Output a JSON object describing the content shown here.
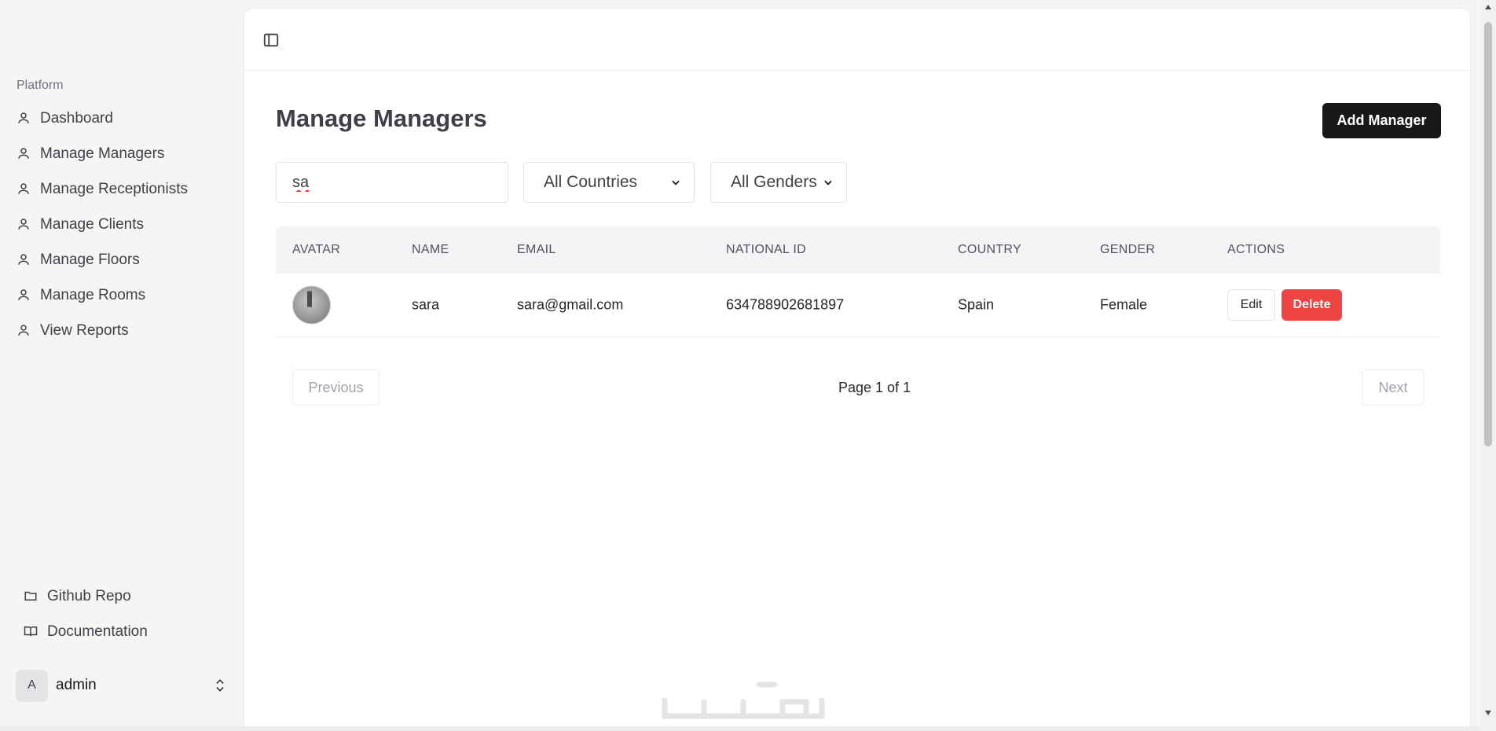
{
  "sidebar": {
    "group_label": "Platform",
    "items": [
      {
        "label": "Dashboard",
        "icon": "user-icon"
      },
      {
        "label": "Manage Managers",
        "icon": "user-icon"
      },
      {
        "label": "Manage Receptionists",
        "icon": "user-icon"
      },
      {
        "label": "Manage Clients",
        "icon": "user-icon"
      },
      {
        "label": "Manage Floors",
        "icon": "user-icon"
      },
      {
        "label": "Manage Rooms",
        "icon": "user-icon"
      },
      {
        "label": "View Reports",
        "icon": "user-icon"
      }
    ],
    "footer_links": [
      {
        "label": "Github Repo",
        "icon": "folder-icon"
      },
      {
        "label": "Documentation",
        "icon": "book-icon"
      }
    ],
    "user": {
      "initial": "A",
      "name": "admin"
    }
  },
  "main": {
    "title": "Manage Managers",
    "add_button": "Add Manager",
    "search_value": "sa",
    "country_filter": "All Countries",
    "gender_filter": "All Genders",
    "table": {
      "headers": [
        "AVATAR",
        "NAME",
        "EMAIL",
        "NATIONAL ID",
        "COUNTRY",
        "GENDER",
        "ACTIONS"
      ],
      "rows": [
        {
          "name": "sara",
          "email": "sara@gmail.com",
          "national_id": "634788902681897",
          "country": "Spain",
          "gender": "Female",
          "edit": "Edit",
          "delete": "Delete"
        }
      ]
    },
    "pagination": {
      "previous": "Previous",
      "info": "Page 1 of 1",
      "next": "Next"
    }
  },
  "colors": {
    "primary": "#18181b",
    "danger": "#ef4444",
    "header_bg": "#f3f4f6",
    "sidebar_bg": "#f5f5f5"
  }
}
